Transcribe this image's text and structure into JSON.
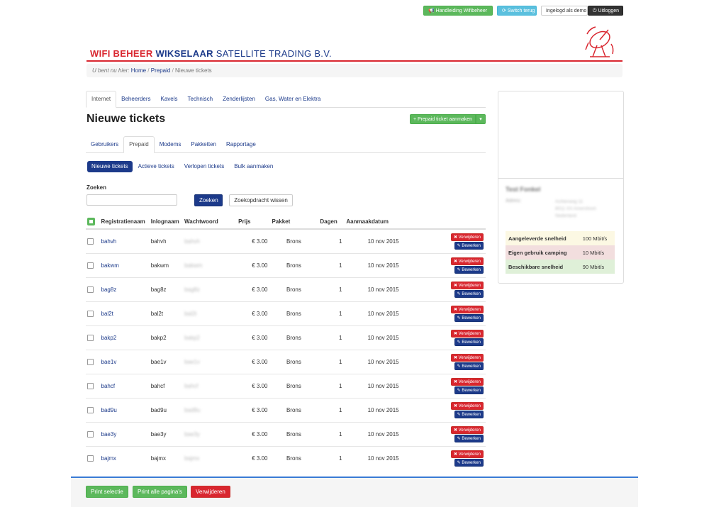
{
  "topbar": {
    "manual": "Handleiding Wifibeheer",
    "switch_back": "Switch terug",
    "logged_in_as": "Ingelogd als demo",
    "logout": "Uitloggen"
  },
  "brand": {
    "part1": "WIFI BEHEER ",
    "part2": "WIKSELAAR",
    "part3": " SATELLITE TRADING B.V."
  },
  "breadcrumb": {
    "prefix": "U bent nu hier:",
    "home": "Home",
    "sep1": "/",
    "prepaid": "Prepaid",
    "sep2": "/",
    "current": "Nieuwe tickets"
  },
  "main_tabs": [
    "Internet",
    "Beheerders",
    "Kavels",
    "Technisch",
    "Zenderlijsten",
    "Gas, Water en Elektra"
  ],
  "page_title": "Nieuwe tickets",
  "create_button": "+ Prepaid ticket aanmaken",
  "sub_tabs": [
    "Gebruikers",
    "Prepaid",
    "Modems",
    "Pakketten",
    "Rapportage"
  ],
  "pills": [
    "Nieuwe tickets",
    "Actieve tickets",
    "Verlopen tickets",
    "Bulk aanmaken"
  ],
  "search": {
    "label": "Zoeken",
    "value": "",
    "submit": "Zoeken",
    "clear": "Zoekopdracht wissen"
  },
  "table": {
    "headers": [
      "Registratienaam",
      "Inlognaam",
      "Wachtwoord",
      "Prijs",
      "Pakket",
      "Dagen",
      "Aanmaakdatum"
    ],
    "delete_label": "✖ Verwijderen",
    "edit_label": "✎ Bewerken",
    "rows": [
      {
        "reg": "bahvh",
        "login": "bahvh",
        "pw": "bahvh",
        "price": "€ 3.00",
        "pkg": "Brons",
        "days": "1",
        "date": "10 nov 2015"
      },
      {
        "reg": "bakwm",
        "login": "bakwm",
        "pw": "bakwm",
        "price": "€ 3.00",
        "pkg": "Brons",
        "days": "1",
        "date": "10 nov 2015"
      },
      {
        "reg": "bag8z",
        "login": "bag8z",
        "pw": "bag8z",
        "price": "€ 3.00",
        "pkg": "Brons",
        "days": "1",
        "date": "10 nov 2015"
      },
      {
        "reg": "bal2t",
        "login": "bal2t",
        "pw": "bal2t",
        "price": "€ 3.00",
        "pkg": "Brons",
        "days": "1",
        "date": "10 nov 2015"
      },
      {
        "reg": "bakp2",
        "login": "bakp2",
        "pw": "bakp2",
        "price": "€ 3.00",
        "pkg": "Brons",
        "days": "1",
        "date": "10 nov 2015"
      },
      {
        "reg": "bae1v",
        "login": "bae1v",
        "pw": "bae1v",
        "price": "€ 3.00",
        "pkg": "Brons",
        "days": "1",
        "date": "10 nov 2015"
      },
      {
        "reg": "bahcf",
        "login": "bahcf",
        "pw": "bahcf",
        "price": "€ 3.00",
        "pkg": "Brons",
        "days": "1",
        "date": "10 nov 2015"
      },
      {
        "reg": "bad9u",
        "login": "bad9u",
        "pw": "bad9u",
        "price": "€ 3.00",
        "pkg": "Brons",
        "days": "1",
        "date": "10 nov 2015"
      },
      {
        "reg": "bae3y",
        "login": "bae3y",
        "pw": "bae3y",
        "price": "€ 3.00",
        "pkg": "Brons",
        "days": "1",
        "date": "10 nov 2015"
      },
      {
        "reg": "bajmx",
        "login": "bajmx",
        "pw": "bajmx",
        "price": "€ 3.00",
        "pkg": "Brons",
        "days": "1",
        "date": "10 nov 2015"
      }
    ]
  },
  "side": {
    "name": "Test Fonkel",
    "address_label": "Adres:",
    "address_lines": [
      "Achterweg 11",
      "8011 XX Amersfoort",
      "Nederland"
    ],
    "speeds": [
      {
        "label": "Aangeleverde snelheid",
        "value": "100 Mbit/s",
        "color": "#fcf8e3"
      },
      {
        "label": "Eigen gebruik camping",
        "value": "10 Mbit/s",
        "color": "#f2dede"
      },
      {
        "label": "Beschikbare snelheid",
        "value": "90 Mbit/s",
        "color": "#dff0d8"
      }
    ]
  },
  "footer": {
    "print_selection": "Print selectie",
    "print_all": "Print alle pagina's",
    "delete": "Verwijderen"
  },
  "colors": {
    "brand_red": "#d9262f",
    "brand_blue": "#1c3a8a",
    "green": "#5cb85c"
  }
}
